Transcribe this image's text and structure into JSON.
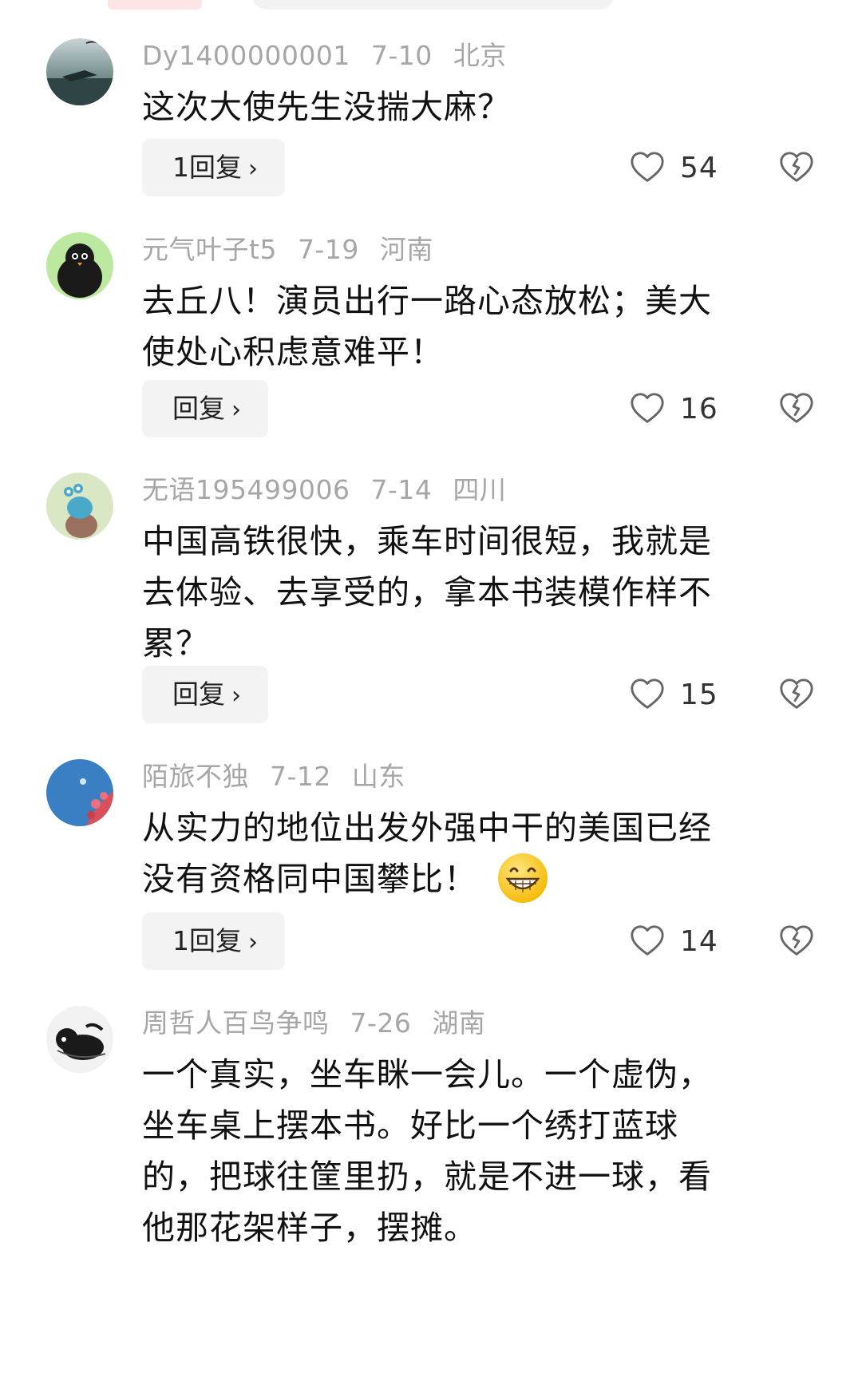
{
  "comments": [
    {
      "user": "Dy1400000001",
      "date": "7-10",
      "location": "北京",
      "lines": [
        "这次大使先生没揣大麻？"
      ],
      "reply_label": "1回复",
      "likes": "54"
    },
    {
      "user": "元气叶子t5",
      "date": "7-19",
      "location": "河南",
      "lines": [
        "去丘八！演员出行一路心态放松；美大",
        "使处心积虑意难平！"
      ],
      "reply_label": "回复",
      "likes": "16"
    },
    {
      "user": "无语195499006",
      "date": "7-14",
      "location": "四川",
      "lines": [
        "中国高铁很快，乘车时间很短，我就是",
        "去体验、去享受的，拿本书装模作样不",
        "累？"
      ],
      "reply_label": "回复",
      "likes": "15"
    },
    {
      "user": "陌旅不独",
      "date": "7-12",
      "location": "山东",
      "lines": [
        "从实力的地位出发外强中干的美国已经",
        "没有资格同中国攀比！"
      ],
      "reply_label": "1回复",
      "likes": "14"
    },
    {
      "user": "周哲人百鸟争鸣",
      "date": "7-26",
      "location": "湖南",
      "lines": [
        "一个真实，坐车眯一会儿。一个虚伪，",
        "坐车桌上摆本书。好比一个绣打蓝球",
        "的，把球往筐里扔，就是不进一球，看",
        "他那花架样子，摆摊。"
      ]
    }
  ],
  "icons": {
    "like": "heart-outline-icon",
    "dislike": "broken-heart-icon",
    "chevron": "chevron-right-icon",
    "emoji": "grinning-emoji-icon"
  },
  "colors": {
    "meta_text": "#a6a6a6",
    "reply_bg": "#f3f3f3",
    "icon_stroke": "#666666"
  },
  "symbols": {
    "chevron": "›"
  }
}
